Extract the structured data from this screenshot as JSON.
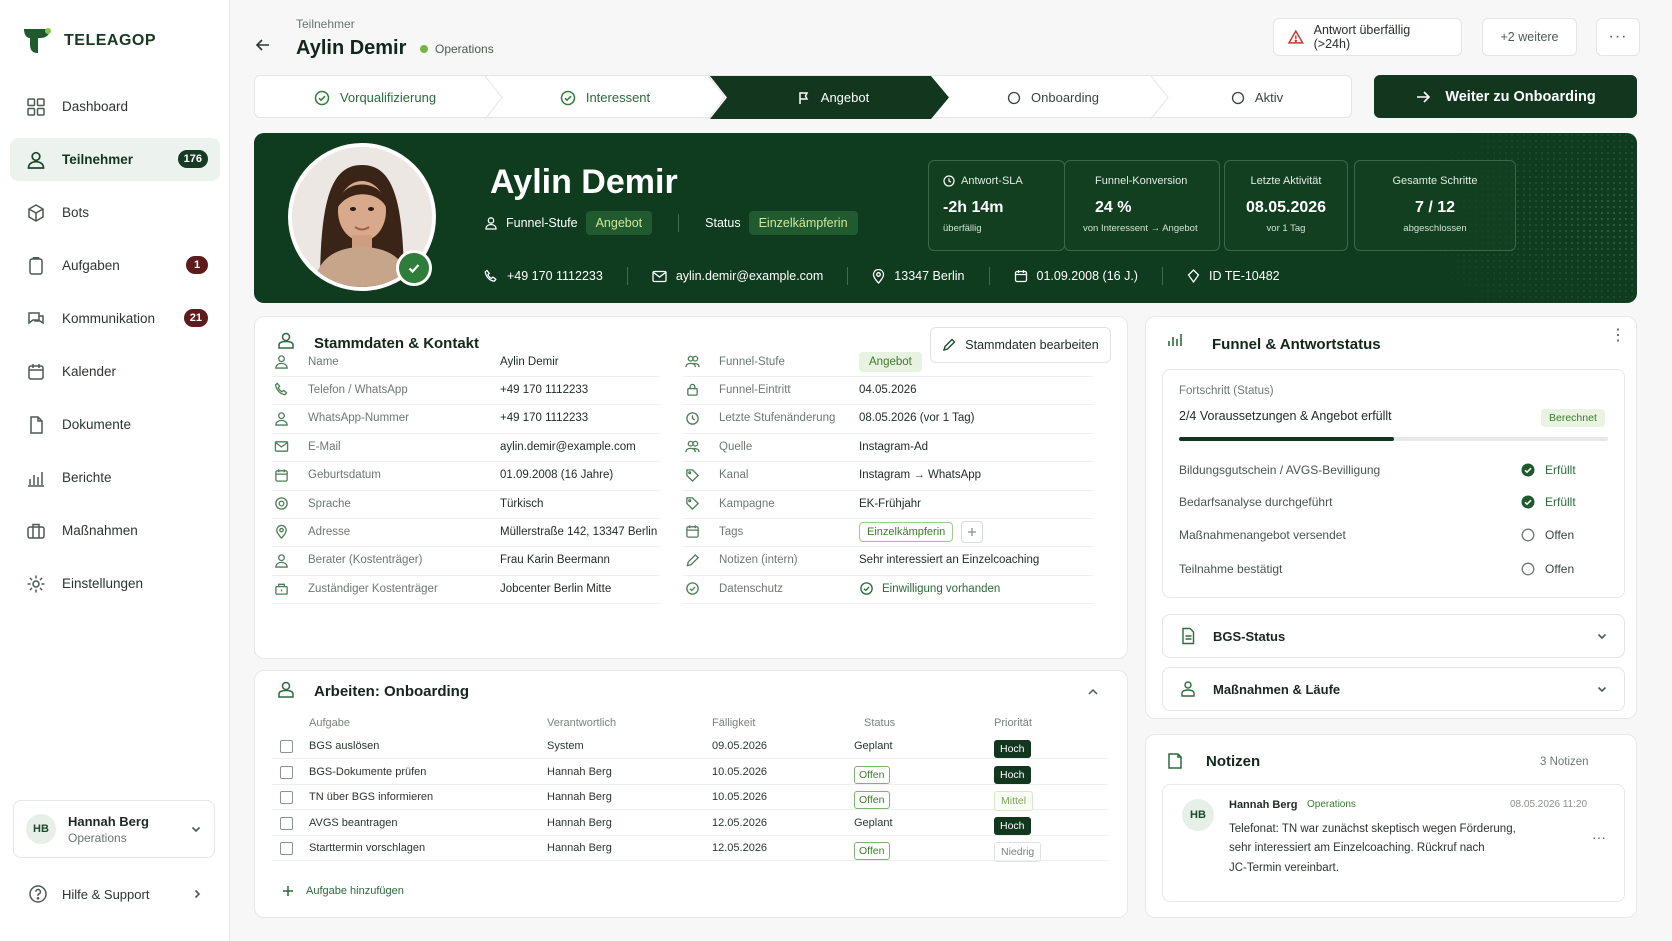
{
  "app": {
    "name": "TELEAGOP"
  },
  "sidebar": {
    "items": [
      {
        "label": "Dashboard",
        "icon": "grid-icon"
      },
      {
        "label": "Teilnehmer",
        "icon": "user-icon",
        "badge": "176",
        "active": true
      },
      {
        "label": "Bots",
        "icon": "cube-icon"
      },
      {
        "label": "Aufgaben",
        "icon": "clipboard-icon",
        "badge": "1"
      },
      {
        "label": "Kommunikation",
        "icon": "chat-icon",
        "badge": "21"
      },
      {
        "label": "Kalender",
        "icon": "calendar-icon"
      },
      {
        "label": "Dokumente",
        "icon": "document-icon"
      },
      {
        "label": "Berichte",
        "icon": "bar-chart-icon"
      },
      {
        "label": "Maßnahmen",
        "icon": "briefcase-icon"
      },
      {
        "label": "Einstellungen",
        "icon": "gear-icon"
      }
    ],
    "user": {
      "initials": "HB",
      "name": "Hannah Berg",
      "role": "Operations"
    },
    "help": "Hilfe & Support"
  },
  "header": {
    "breadcrumb": "Teilnehmer",
    "title": "Aylin Demir",
    "team": "Operations",
    "alert": "Antwort überfällig (>24h)",
    "more": "+2 weitere",
    "dots": "···"
  },
  "stepper": {
    "steps": [
      {
        "label": "Vorqualifizierung",
        "state": "done"
      },
      {
        "label": "Interessent",
        "state": "done"
      },
      {
        "label": "Angebot",
        "state": "current"
      },
      {
        "label": "Onboarding",
        "state": "todo"
      },
      {
        "label": "Aktiv",
        "state": "todo"
      }
    ],
    "next_button": "Weiter zu Onboarding"
  },
  "hero": {
    "name": "Aylin Demir",
    "funnel_label": "Funnel-Stufe",
    "funnel_value": "Angebot",
    "status_label": "Status",
    "status_value": "Einzelkämpferin",
    "phone": "+49 170 1112233",
    "email": "aylin.demir@example.com",
    "location": "13347 Berlin",
    "birth": "01.09.2008 (16 J.)",
    "id": "ID TE-10482",
    "kpis": [
      {
        "label": "Antwort-SLA",
        "value": "-2h 14m",
        "sub": "überfällig"
      },
      {
        "label": "Funnel-Konversion",
        "value": "24 %",
        "sub": "von Interessent → Angebot"
      },
      {
        "label": "Letzte Aktivität",
        "value": "08.05.2026",
        "sub": "vor 1 Tag"
      },
      {
        "label": "Gesamte Schritte",
        "value": "7 / 12",
        "sub": "abgeschlossen"
      }
    ]
  },
  "stammdaten": {
    "title": "Stammdaten & Kontakt",
    "edit_button": "Stammdaten bearbeiten",
    "left": [
      {
        "label": "Name",
        "value": "Aylin Demir",
        "icon": "user-icon"
      },
      {
        "label": "Telefon / WhatsApp",
        "value": "+49 170 1112233",
        "icon": "phone-icon"
      },
      {
        "label": "WhatsApp-Nummer",
        "value": "+49 170 1112233",
        "icon": "user-icon"
      },
      {
        "label": "E-Mail",
        "value": "aylin.demir@example.com",
        "icon": "mail-icon"
      },
      {
        "label": "Geburtsdatum",
        "value": "01.09.2008 (16 Jahre)",
        "icon": "calendar-icon"
      },
      {
        "label": "Sprache",
        "value": "Türkisch",
        "icon": "globe-icon"
      },
      {
        "label": "Adresse",
        "value": "Müllerstraße 142, 13347 Berlin",
        "icon": "pin-icon"
      },
      {
        "label": "Berater (Kostenträger)",
        "value": "Frau Karin Beermann",
        "icon": "user-icon"
      },
      {
        "label": "Zuständiger Kostenträger",
        "value": "Jobcenter Berlin Mitte",
        "icon": "building-icon"
      }
    ],
    "right": [
      {
        "label": "Funnel-Stufe",
        "value": "Angebot",
        "icon": "users-icon"
      },
      {
        "label": "Funnel-Eintritt",
        "value": "04.05.2026",
        "icon": "lock-icon"
      },
      {
        "label": "Letzte Stufenänderung",
        "value": "08.05.2026 (vor 1 Tag)",
        "icon": "clock-icon"
      },
      {
        "label": "Quelle",
        "value": "Instagram-Ad",
        "icon": "users-icon"
      },
      {
        "label": "Kanal",
        "value": "Instagram → WhatsApp",
        "icon": "tag-icon"
      },
      {
        "label": "Kampagne",
        "value": "EK-Frühjahr",
        "icon": "tag-icon"
      },
      {
        "label": "Tags",
        "value": "Einzelkämpferin",
        "icon": "calendar-icon"
      },
      {
        "label": "Notizen (intern)",
        "value": "Sehr interessiert an Einzelcoaching",
        "icon": "pencil-icon"
      },
      {
        "label": "Datenschutz",
        "value": "Einwilligung vorhanden",
        "icon": "check-circle-icon"
      }
    ]
  },
  "tasks": {
    "title": "Arbeiten: Onboarding",
    "columns": [
      "Aufgabe",
      "Verantwortlich",
      "Fälligkeit",
      "Status",
      "Priorität"
    ],
    "rows": [
      {
        "task": "BGS auslösen",
        "owner": "System",
        "due": "09.05.2026",
        "status": "Geplant",
        "priority": "Hoch"
      },
      {
        "task": "BGS-Dokumente prüfen",
        "owner": "Hannah Berg",
        "due": "10.05.2026",
        "status": "Offen",
        "priority": "Hoch"
      },
      {
        "task": "TN über BGS informieren",
        "owner": "Hannah Berg",
        "due": "10.05.2026",
        "status": "Offen",
        "priority": "Mittel"
      },
      {
        "task": "AVGS beantragen",
        "owner": "Hannah Berg",
        "due": "12.05.2026",
        "status": "Geplant",
        "priority": "Hoch"
      },
      {
        "task": "Starttermin vorschlagen",
        "owner": "Hannah Berg",
        "due": "12.05.2026",
        "status": "Offen",
        "priority": "Niedrig"
      }
    ],
    "add": "Aufgabe hinzufügen"
  },
  "funnel": {
    "title": "Funnel & Antwortstatus",
    "progress_label": "Fortschritt (Status)",
    "progress_text": "2/4 Voraussetzungen & Angebot erfüllt",
    "progress_badge": "Berechnet",
    "progress_fraction": 0.5,
    "requirements": [
      {
        "label": "Bildungsgutschein / AVGS-Bevilligung",
        "status": "Erfüllt",
        "done": true
      },
      {
        "label": "Bedarfsanalyse durchgeführt",
        "status": "Erfüllt",
        "done": true
      },
      {
        "label": "Maßnahmenangebot versendet",
        "status": "Offen",
        "done": false
      },
      {
        "label": "Teilnahme bestätigt",
        "status": "Offen",
        "done": false
      }
    ],
    "accordions": [
      "BGS-Status",
      "Maßnahmen & Läufe"
    ]
  },
  "notes": {
    "title": "Notizen",
    "count": "3 Notizen",
    "items": [
      {
        "initials": "HB",
        "author": "Hannah Berg",
        "team": "Operations",
        "date": "08.05.2026 11:20",
        "line1": "Telefonat: TN war zunächst skeptisch wegen Förderung,",
        "line2": "sehr interessiert am Einzelcoaching. Rückruf nach",
        "line3": "JC-Termin vereinbart."
      }
    ]
  },
  "colors": {
    "primary": "#13361f",
    "accent": "#78b440",
    "danger": "#5e1b1b"
  }
}
